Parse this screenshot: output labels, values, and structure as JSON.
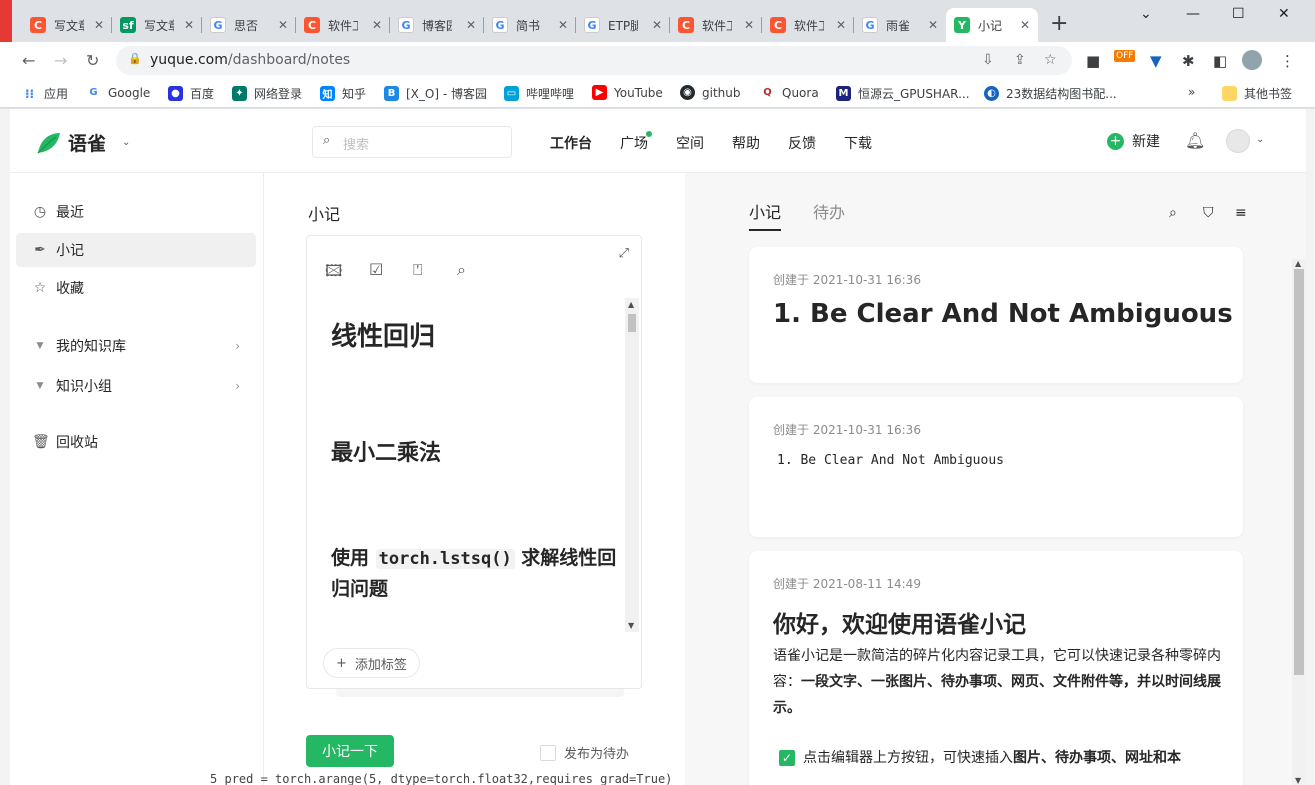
{
  "browser": {
    "tabs": [
      {
        "label": "写文章",
        "fav": "C",
        "color": "#fc5531"
      },
      {
        "label": "写文章",
        "fav": "sf",
        "color": "#009a61"
      },
      {
        "label": "思否",
        "fav": "G",
        "color": "#4285f4"
      },
      {
        "label": "软件工",
        "fav": "C",
        "color": "#fc5531"
      },
      {
        "label": "博客园",
        "fav": "G",
        "color": "#4285f4"
      },
      {
        "label": "简书",
        "fav": "G",
        "color": "#4285f4"
      },
      {
        "label": "ETP腿",
        "fav": "G",
        "color": "#4285f4"
      },
      {
        "label": "软件工",
        "fav": "C",
        "color": "#fc5531"
      },
      {
        "label": "软件工",
        "fav": "C",
        "color": "#fc5531"
      },
      {
        "label": "雨雀",
        "fav": "G",
        "color": "#4285f4"
      },
      {
        "label": "小记",
        "fav": "Y",
        "color": "#25b864"
      }
    ],
    "url_host": "yuque.com",
    "url_path": "/dashboard/notes",
    "bookmarks": [
      {
        "label": "应用",
        "icon": "apps-icon"
      },
      {
        "label": "Google",
        "icon": "google-icon"
      },
      {
        "label": "百度",
        "icon": "baidu-icon"
      },
      {
        "label": "网络登录",
        "icon": "network-icon"
      },
      {
        "label": "知乎",
        "icon": "zhihu-icon"
      },
      {
        "label": "[X_O] - 博客园",
        "icon": "cnblogs-icon"
      },
      {
        "label": "哔哩哔哩",
        "icon": "bilibili-icon"
      },
      {
        "label": "YouTube",
        "icon": "youtube-icon"
      },
      {
        "label": "github",
        "icon": "github-icon"
      },
      {
        "label": "Quora",
        "icon": "quora-icon"
      },
      {
        "label": "恒源云_GPUSHAR...",
        "icon": "hengyuan-icon"
      },
      {
        "label": "23数据结构图书配...",
        "icon": "book-icon"
      }
    ],
    "other_bookmarks": "其他书签",
    "ext_badge": "OFF"
  },
  "app": {
    "brand": "语雀",
    "search_placeholder": "搜索",
    "nav": [
      "工作台",
      "广场",
      "空间",
      "帮助",
      "反馈",
      "下载"
    ],
    "new_label": "新建",
    "accent": "#25b864"
  },
  "sidebar": {
    "items": [
      {
        "label": "最近"
      },
      {
        "label": "小记"
      },
      {
        "label": "收藏"
      },
      {
        "label": "我的知识库"
      },
      {
        "label": "知识小组"
      },
      {
        "label": "回收站"
      }
    ]
  },
  "editor": {
    "title": "小记",
    "h1": "线性回归",
    "h2": "最小二乘法",
    "h3_prefix": "使用 ",
    "h3_code": "torch.lstsq()",
    "h3_suffix": " 求解线性回归问题",
    "add_tag": "添加标签",
    "submit": "小记一下",
    "todo_label": "发布为待办"
  },
  "list": {
    "tabs": [
      "小记",
      "待办"
    ],
    "cards": [
      {
        "meta": "创建于 2021-10-31 16:36",
        "title": "1. Be Clear And Not Ambiguous"
      },
      {
        "meta": "创建于 2021-10-31 16:36",
        "text": "1. Be Clear And Not Ambiguous"
      },
      {
        "meta": "创建于 2021-08-11 14:49",
        "title": "你好，欢迎使用语雀小记",
        "para_plain": "语雀小记是一款简洁的碎片化内容记录工具，它可以快速记录各种零碎内容：",
        "para_bold": "一段文字、一张图片、待办事项、网页、文件附件等，并以时间线展示。",
        "check_plain": "点击编辑器上方按钮，可快速插入",
        "check_bold": "图片、待办事项、网址和本"
      }
    ]
  },
  "underlay": {
    "line_no": "5",
    "code": "pred = torch.arange(5, dtype=torch.float32,requires_grad=True)"
  }
}
